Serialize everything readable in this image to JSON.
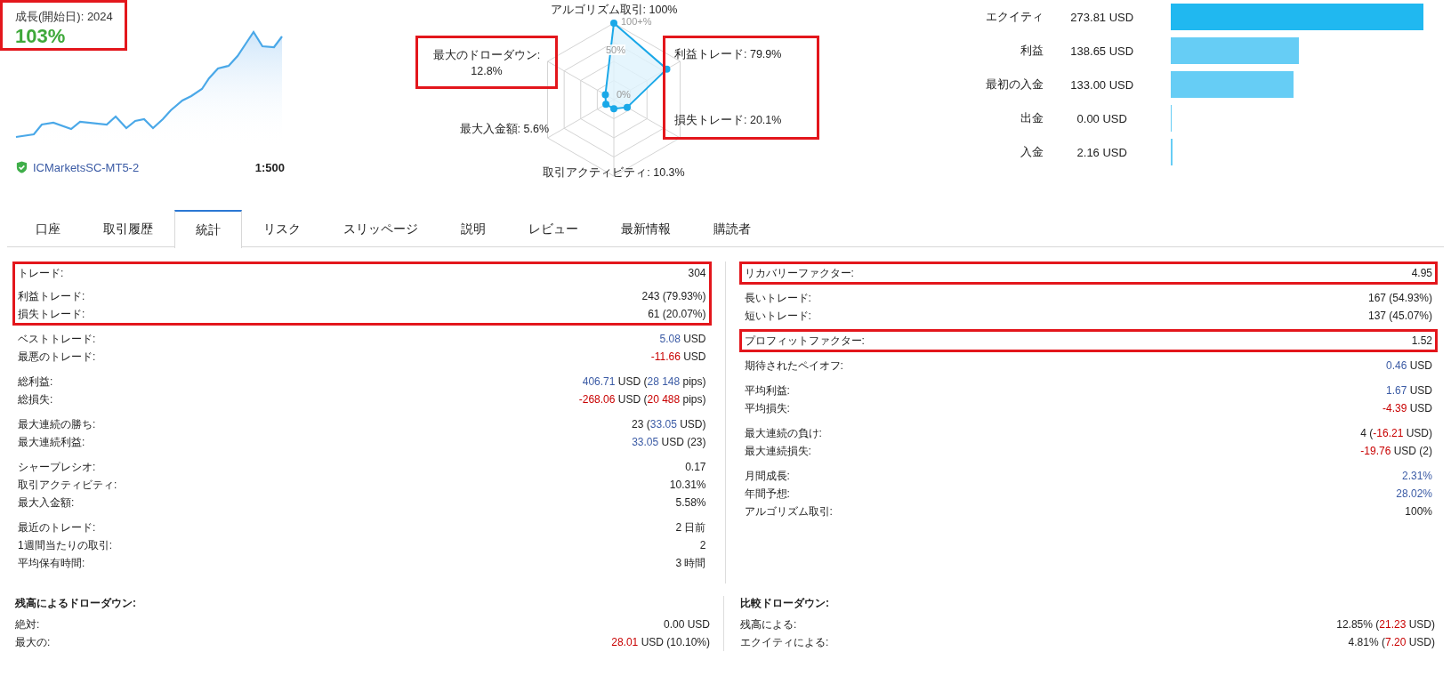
{
  "growth": {
    "label": "成長(開始日): ",
    "year": "2024",
    "value": "103%",
    "highlighted": true
  },
  "broker": {
    "name": "ICMarketsSC-MT5-2",
    "verified": true,
    "leverage": "1:500"
  },
  "radar": {
    "ticks": [
      "100+%",
      "50%",
      "0%"
    ],
    "axes": [
      {
        "label": "アルゴリズム取引: 100%",
        "highlighted": false
      },
      {
        "label": "最大のドローダウン:",
        "value": "12.8%",
        "highlighted": true
      },
      {
        "label": "利益トレード: 79.9%",
        "highlighted": true
      },
      {
        "label": "最大入金額: 5.6%",
        "highlighted": false
      },
      {
        "label": "損失トレード: 20.1%",
        "highlighted": true
      },
      {
        "label": "取引アクティビティ: 10.3%",
        "highlighted": false
      }
    ]
  },
  "balance_bars": [
    {
      "label": "エクイティ",
      "value": "273.81 USD",
      "color": "#20b8f0"
    },
    {
      "label": "利益",
      "value": "138.65 USD",
      "color": "#66cdf5"
    },
    {
      "label": "最初の入金",
      "value": "133.00 USD",
      "color": "#66cdf5"
    },
    {
      "label": "出金",
      "value": "0.00 USD",
      "color": "#66cdf5"
    },
    {
      "label": "入金",
      "value": "2.16 USD",
      "color": "#66cdf5"
    }
  ],
  "tabs": [
    {
      "label": "口座",
      "selected": false
    },
    {
      "label": "取引履歴",
      "selected": false
    },
    {
      "label": "統計",
      "selected": true
    },
    {
      "label": "リスク",
      "selected": false
    },
    {
      "label": "スリッページ",
      "selected": false
    },
    {
      "label": "説明",
      "selected": false
    },
    {
      "label": "レビュー",
      "selected": false
    },
    {
      "label": "最新情報",
      "selected": false
    },
    {
      "label": "購読者",
      "selected": false
    }
  ],
  "stats_left": [
    {
      "highlighted": true,
      "rows": [
        {
          "label": "トレード:",
          "value": [
            {
              "text": "304"
            }
          ]
        }
      ]
    },
    {
      "highlighted": true,
      "rows": [
        {
          "label": "利益トレード:",
          "value": [
            {
              "text": "243 (79.93%)"
            }
          ]
        },
        {
          "label": "損失トレード:",
          "value": [
            {
              "text": "61 (20.07%)"
            }
          ]
        }
      ]
    },
    {
      "highlighted": false,
      "rows": [
        {
          "label": "ベストトレード:",
          "value": [
            {
              "text": "5.08",
              "color": "#3b5ba5"
            },
            {
              "text": " USD"
            }
          ]
        },
        {
          "label": "最悪のトレード:",
          "value": [
            {
              "text": "-11.66",
              "color": "#c80000"
            },
            {
              "text": " USD"
            }
          ]
        }
      ]
    },
    {
      "highlighted": false,
      "rows": [
        {
          "label": "総利益:",
          "value": [
            {
              "text": "406.71",
              "color": "#3b5ba5"
            },
            {
              "text": " USD ("
            },
            {
              "text": "28 148",
              "color": "#3b5ba5"
            },
            {
              "text": " pips)"
            }
          ]
        },
        {
          "label": "総損失:",
          "value": [
            {
              "text": "-268.06",
              "color": "#c80000"
            },
            {
              "text": " USD ("
            },
            {
              "text": "20 488",
              "color": "#c80000"
            },
            {
              "text": " pips)"
            }
          ]
        }
      ]
    },
    {
      "highlighted": false,
      "rows": [
        {
          "label": "最大連続の勝ち:",
          "value": [
            {
              "text": "23 ("
            },
            {
              "text": "33.05",
              "color": "#3b5ba5"
            },
            {
              "text": " USD)"
            }
          ]
        },
        {
          "label": "最大連続利益:",
          "value": [
            {
              "text": "33.05",
              "color": "#3b5ba5"
            },
            {
              "text": " USD (23)"
            }
          ]
        }
      ]
    },
    {
      "highlighted": false,
      "rows": [
        {
          "label": "シャープレシオ:",
          "value": [
            {
              "text": "0.17"
            }
          ]
        },
        {
          "label": "取引アクティビティ:",
          "value": [
            {
              "text": "10.31%"
            }
          ]
        },
        {
          "label": "最大入金額:",
          "value": [
            {
              "text": "5.58%"
            }
          ]
        }
      ]
    },
    {
      "highlighted": false,
      "rows": [
        {
          "label": "最近のトレード:",
          "value": [
            {
              "text": "2 日前"
            }
          ]
        },
        {
          "label": "1週間当たりの取引:",
          "value": [
            {
              "text": "2"
            }
          ]
        },
        {
          "label": "平均保有時間:",
          "value": [
            {
              "text": "3 時間"
            }
          ]
        }
      ]
    }
  ],
  "stats_right": [
    {
      "highlighted": true,
      "rows": [
        {
          "label": "リカバリーファクター:",
          "value": [
            {
              "text": "4.95"
            }
          ]
        }
      ]
    },
    {
      "highlighted": false,
      "rows": [
        {
          "label": "長いトレード:",
          "value": [
            {
              "text": "167 (54.93%)"
            }
          ]
        },
        {
          "label": "短いトレード:",
          "value": [
            {
              "text": "137 (45.07%)"
            }
          ]
        }
      ]
    },
    {
      "highlighted": true,
      "rows": [
        {
          "label": "プロフィットファクター:",
          "value": [
            {
              "text": "1.52"
            }
          ]
        }
      ]
    },
    {
      "highlighted": false,
      "rows": [
        {
          "label": "期待されたペイオフ:",
          "value": [
            {
              "text": "0.46",
              "color": "#3b5ba5"
            },
            {
              "text": " USD"
            }
          ]
        }
      ]
    },
    {
      "highlighted": false,
      "rows": [
        {
          "label": "平均利益:",
          "value": [
            {
              "text": "1.67",
              "color": "#3b5ba5"
            },
            {
              "text": " USD"
            }
          ]
        },
        {
          "label": "平均損失:",
          "value": [
            {
              "text": "-4.39",
              "color": "#c80000"
            },
            {
              "text": " USD"
            }
          ]
        }
      ]
    },
    {
      "highlighted": false,
      "rows": [
        {
          "label": "最大連続の負け:",
          "value": [
            {
              "text": "4 ("
            },
            {
              "text": "-16.21",
              "color": "#c80000"
            },
            {
              "text": " USD)"
            }
          ]
        },
        {
          "label": "最大連続損失:",
          "value": [
            {
              "text": "-19.76",
              "color": "#c80000"
            },
            {
              "text": " USD (2)"
            }
          ]
        }
      ]
    },
    {
      "highlighted": false,
      "rows": [
        {
          "label": "月間成長:",
          "value": [
            {
              "text": "2.31%",
              "color": "#3b5ba5"
            }
          ]
        },
        {
          "label": "年間予想:",
          "value": [
            {
              "text": "28.02%",
              "color": "#3b5ba5"
            }
          ]
        },
        {
          "label": "アルゴリズム取引:",
          "value": [
            {
              "text": "100%"
            }
          ]
        }
      ]
    }
  ],
  "drawdown_left": {
    "title": "残高によるドローダウン:",
    "rows": [
      {
        "label": "絶対:",
        "value": [
          {
            "text": "0.00 USD"
          }
        ]
      },
      {
        "label": "最大の:",
        "value": [
          {
            "text": "28.01",
            "color": "#c80000"
          },
          {
            "text": " USD (10.10%)"
          }
        ]
      }
    ]
  },
  "drawdown_right": {
    "title": "比較ドローダウン:",
    "rows": [
      {
        "label": "残高による:",
        "value": [
          {
            "text": "12.85% ("
          },
          {
            "text": "21.23",
            "color": "#c80000"
          },
          {
            "text": " USD)"
          }
        ]
      },
      {
        "label": "エクイティによる:",
        "value": [
          {
            "text": "4.81% ("
          },
          {
            "text": "7.20",
            "color": "#c80000"
          },
          {
            "text": " USD)"
          }
        ]
      }
    ]
  }
}
